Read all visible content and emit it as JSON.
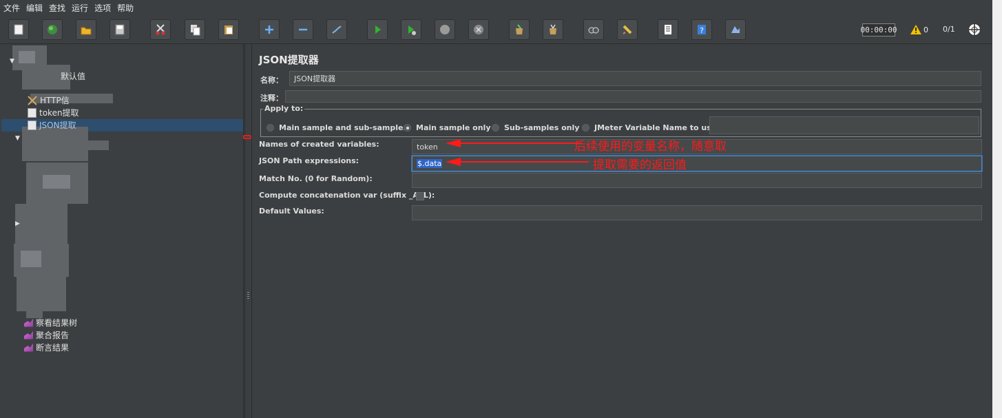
{
  "menu": [
    "文件",
    "编辑",
    "查找",
    "运行",
    "选项",
    "帮助"
  ],
  "toolbar": {
    "icons": [
      "new-icon",
      "templates-icon",
      "open-icon",
      "save-icon",
      "cut-icon",
      "copy-icon",
      "paste-icon",
      "expand-icon",
      "collapse-icon",
      "toggle-icon",
      "start-icon",
      "start-no-pause-icon",
      "stop-icon",
      "shutdown-icon",
      "clear-icon",
      "clear-all-icon",
      "search-icon",
      "reset-search-icon",
      "function-helper-icon",
      "help-icon",
      "remote-icon"
    ],
    "timer": "00:00:00",
    "warning_count": "0",
    "threads": "0/1"
  },
  "tree": {
    "items": [
      {
        "label": "默认值"
      },
      {
        "label": "HTTP信"
      },
      {
        "label": "token提取"
      },
      {
        "label": "JSON提取"
      },
      {
        "label": "察看结果树"
      },
      {
        "label": "聚合报告"
      },
      {
        "label": "断言结果"
      }
    ]
  },
  "panel": {
    "title": "JSON提取器",
    "name_label": "名称：",
    "name_value": "JSON提取器",
    "comment_label": "注释：",
    "comment_value": "",
    "apply_to_label": "Apply to:",
    "apply_options": [
      "Main sample and sub-samples",
      "Main sample only",
      "Sub-samples only",
      "JMeter Variable Name to use"
    ],
    "apply_selected": "Main sample only",
    "jmeter_variable_value": "",
    "names_label": "Names of created variables:",
    "names_value": "token",
    "path_label": "JSON Path expressions:",
    "path_value": "$.data",
    "match_label": "Match No. (0 for Random):",
    "match_value": "",
    "concat_label": "Compute concatenation var (suffix _ALL):",
    "concat_checked": false,
    "default_label": "Default Values:",
    "default_value": ""
  },
  "annotations": {
    "names_note": "后续使用的变量名称，随意取",
    "path_note": "提取需要的返回值"
  },
  "colors": {
    "annotation": "#ff1a1a",
    "selection": "#2d4e6e",
    "highlight": "#2f65ca"
  }
}
